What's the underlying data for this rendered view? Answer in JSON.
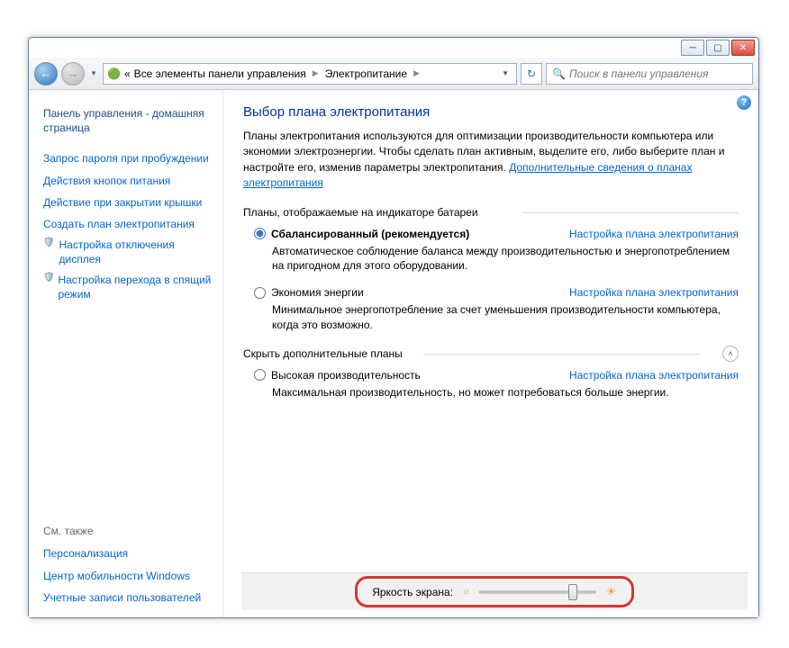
{
  "window": {
    "breadcrumb": {
      "prefix": "«",
      "part1": "Все элементы панели управления",
      "part2": "Электропитание"
    },
    "search_placeholder": "Поиск в панели управления"
  },
  "sidebar": {
    "home": "Панель управления - домашняя страница",
    "links": [
      "Запрос пароля при пробуждении",
      "Действия кнопок питания",
      "Действие при закрытии крышки",
      "Создать план электропитания",
      "Настройка отключения дисплея",
      "Настройка перехода в спящий режим"
    ],
    "see_also_title": "См. также",
    "see_also": [
      "Персонализация",
      "Центр мобильности Windows",
      "Учетные записи пользователей"
    ]
  },
  "content": {
    "title": "Выбор плана электропитания",
    "intro_text": "Планы электропитания используются для оптимизации производительности компьютера или экономии электроэнергии. Чтобы сделать план активным, выделите его, либо выберите план и настройте его, изменив параметры электропитания. ",
    "intro_link": "Дополнительные сведения о планах электропитания",
    "group_battery": "Планы, отображаемые на индикаторе батареи",
    "plan_link": "Настройка плана электропитания",
    "plans": [
      {
        "name": "Сбалансированный (рекомендуется)",
        "desc": "Автоматическое соблюдение баланса между производительностью и энергопотреблением на пригодном для этого оборудовании.",
        "selected": true
      },
      {
        "name": "Экономия энергии",
        "desc": "Минимальное энергопотребление за счет уменьшения производительности компьютера, когда это возможно.",
        "selected": false
      }
    ],
    "group_hide": "Скрыть дополнительные планы",
    "extra_plan": {
      "name": "Высокая производительность",
      "desc": "Максимальная производительность, но может потребоваться больше энергии."
    },
    "brightness_label": "Яркость экрана:",
    "brightness_percent": 82
  }
}
